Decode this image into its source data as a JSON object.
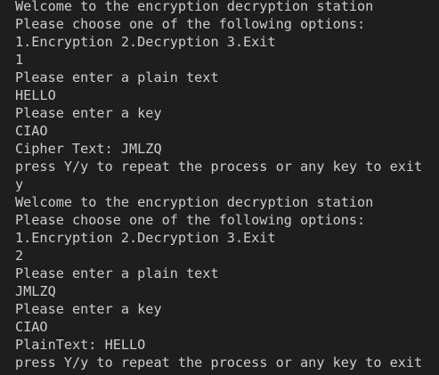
{
  "terminal": {
    "lines": [
      "Welcome to the encryption decryption station",
      "Please choose one of the following options:",
      "1.Encryption 2.Decryption 3.Exit",
      "1",
      "Please enter a plain text",
      "HELLO",
      "Please enter a key",
      "CIAO",
      "Cipher Text: JMLZQ",
      "press Y/y to repeat the process or any key to exit",
      "y",
      "Welcome to the encryption decryption station",
      "Please choose one of the following options:",
      "1.Encryption 2.Decryption 3.Exit",
      "2",
      "Please enter a plain text",
      "JMLZQ",
      "Please enter a key",
      "CIAO",
      "PlainText: HELLO",
      "press Y/y to repeat the process or any key to exit"
    ]
  }
}
